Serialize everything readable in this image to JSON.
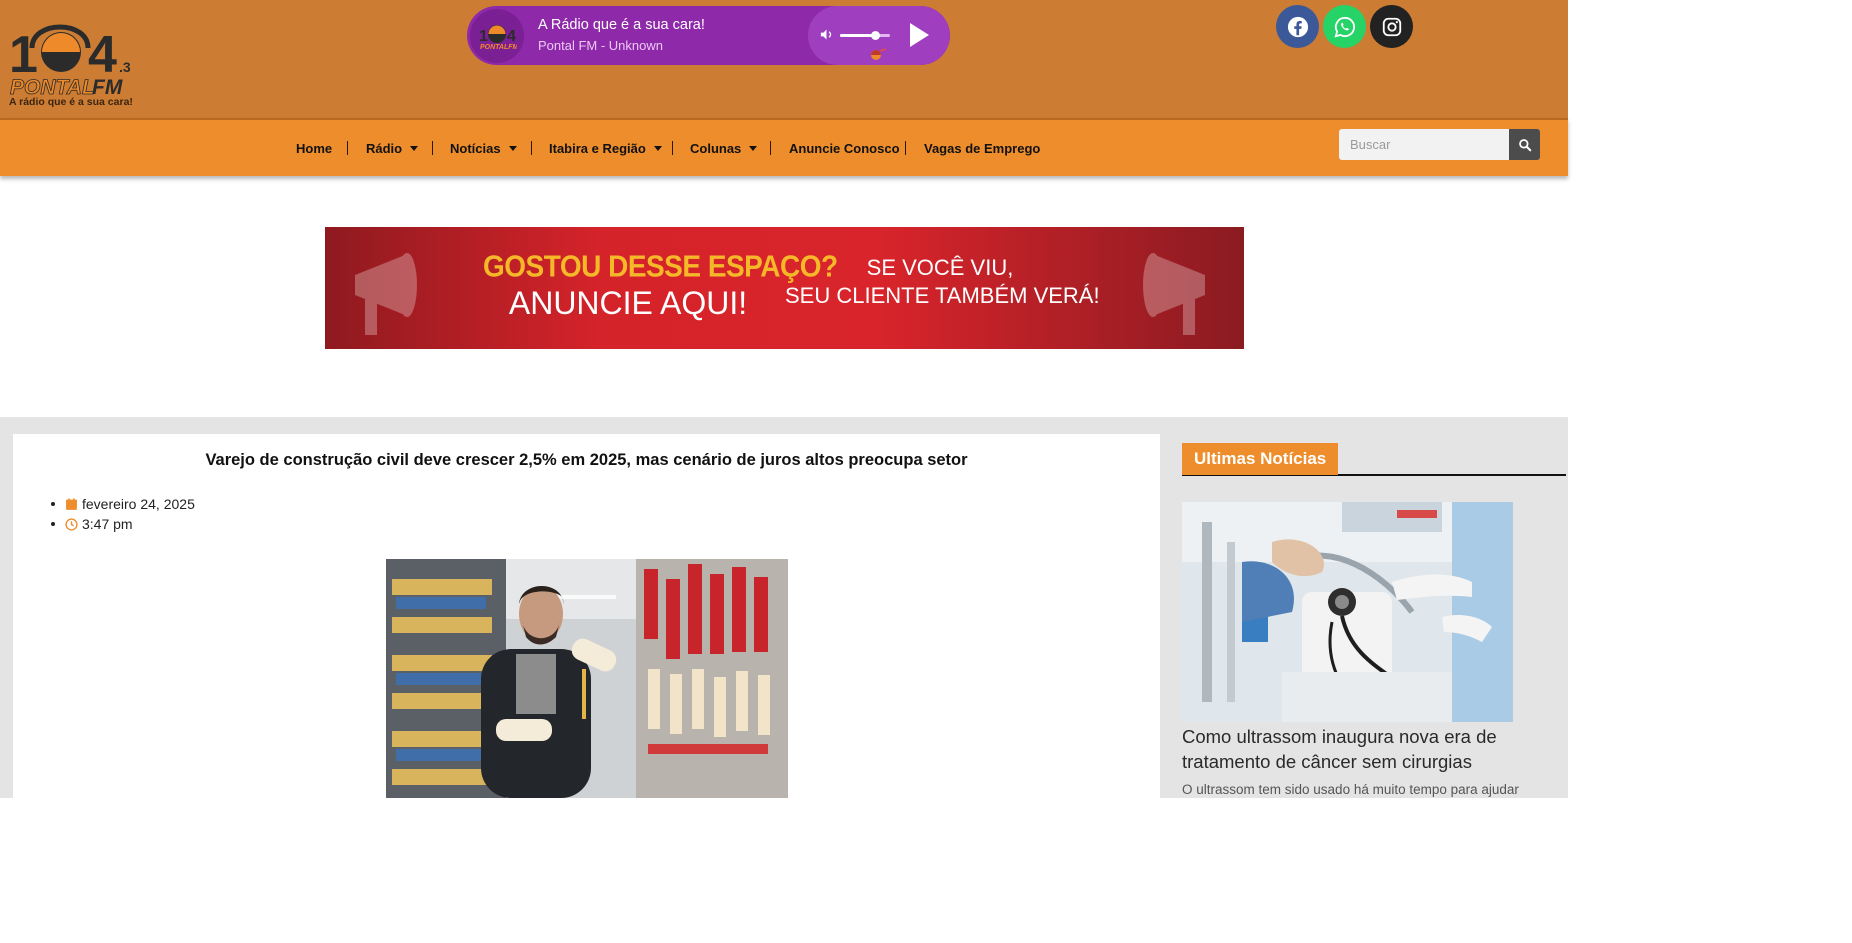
{
  "header": {
    "logo_text_number": "104",
    "logo_text_decimal": ".3",
    "logo_brand": "PONTALFM",
    "logo_tagline": "A rádio que é a sua cara!",
    "player": {
      "title": "A Rádio que é a sua cara!",
      "subtitle": "Pontal FM - Unknown",
      "volume_level": 0.7
    },
    "social": [
      "facebook-icon",
      "whatsapp-icon",
      "instagram-icon"
    ]
  },
  "nav": {
    "items": [
      {
        "label": "Home",
        "has_dropdown": false
      },
      {
        "label": "Rádio",
        "has_dropdown": true
      },
      {
        "label": "Notícias",
        "has_dropdown": true
      },
      {
        "label": "Itabira e Região",
        "has_dropdown": true
      },
      {
        "label": "Colunas",
        "has_dropdown": true
      },
      {
        "label": "Anuncie Conosco",
        "has_dropdown": false
      },
      {
        "label": "Vagas de Emprego",
        "has_dropdown": false
      }
    ],
    "search_placeholder": "Buscar"
  },
  "ad": {
    "line1": "GOSTOU DESSE ESPAÇO?",
    "line2": "ANUNCIE AQUI!",
    "line3": "SE VOCÊ VIU,",
    "line4": "SEU CLIENTE TAMBÉM VERÁ!"
  },
  "article": {
    "title": "Varejo de construção civil deve crescer 2,5% em 2025, mas cenário de juros altos preocupa setor",
    "date": "fevereiro 24, 2025",
    "time": "3:47 pm"
  },
  "sidebar": {
    "section_title": "Ultimas Notícias",
    "headline": "Como ultrassom inaugura nova era de tratamento de câncer sem cirurgias",
    "excerpt": "O ultrassom tem sido usado há muito tempo para ajudar"
  },
  "colors": {
    "header_bg": "#cd7d33",
    "nav_bg": "#ee8d2b",
    "player_bg": "#8e2aa9",
    "accent": "#ee8d2b"
  }
}
